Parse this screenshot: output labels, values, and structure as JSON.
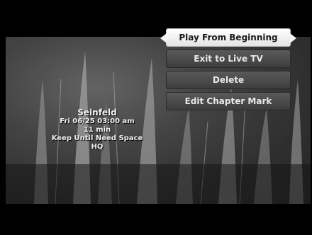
{
  "program": {
    "title": "Seinfeld",
    "datetime": "Fri 06/25 03:00 am",
    "duration": "11 min",
    "keep_policy": "Keep Until Need Space",
    "quality": "HQ"
  },
  "menu": {
    "items": [
      {
        "label": "Play From Beginning",
        "selected": true
      },
      {
        "label": "Exit to Live TV",
        "selected": false
      },
      {
        "label": "Delete",
        "selected": false
      },
      {
        "label": "Edit Chapter Mark",
        "selected": false
      }
    ]
  },
  "colors": {
    "menu_selected_bg": "#f0f0f0",
    "menu_normal_bg": "#4a4a4a",
    "menu_text_normal": "#e8e8e8",
    "menu_text_selected": "#1a1a1a"
  }
}
